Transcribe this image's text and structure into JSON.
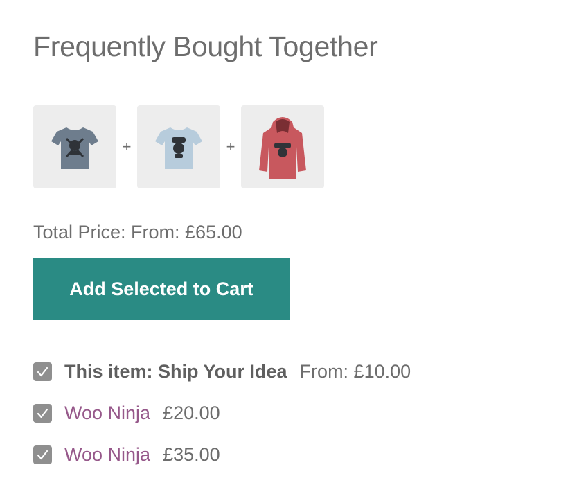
{
  "heading": "Frequently Bought Together",
  "products": [
    {
      "name": "Ship Your Idea",
      "image_icon": "tshirt-icon",
      "color": "#6e7d8d"
    },
    {
      "name": "Woo Ninja",
      "image_icon": "tshirt-icon",
      "color": "#b7ccdc"
    },
    {
      "name": "Woo Ninja",
      "image_icon": "hoodie-icon",
      "color": "#c8585e"
    }
  ],
  "plus_sign": "+",
  "total_price": "Total Price: From: £65.00",
  "add_button_label": "Add Selected to Cart",
  "items": [
    {
      "checked": true,
      "name": "This item: Ship Your Idea",
      "price": "From: £10.00"
    },
    {
      "checked": true,
      "name": "Woo Ninja",
      "price": "£20.00"
    },
    {
      "checked": true,
      "name": "Woo Ninja",
      "price": "£35.00"
    }
  ],
  "colors": {
    "button_bg": "#2a8b84",
    "link": "#96588a",
    "text": "#6d6d6d",
    "checkbox": "#8f8f8f",
    "thumb_bg": "#ededed"
  }
}
